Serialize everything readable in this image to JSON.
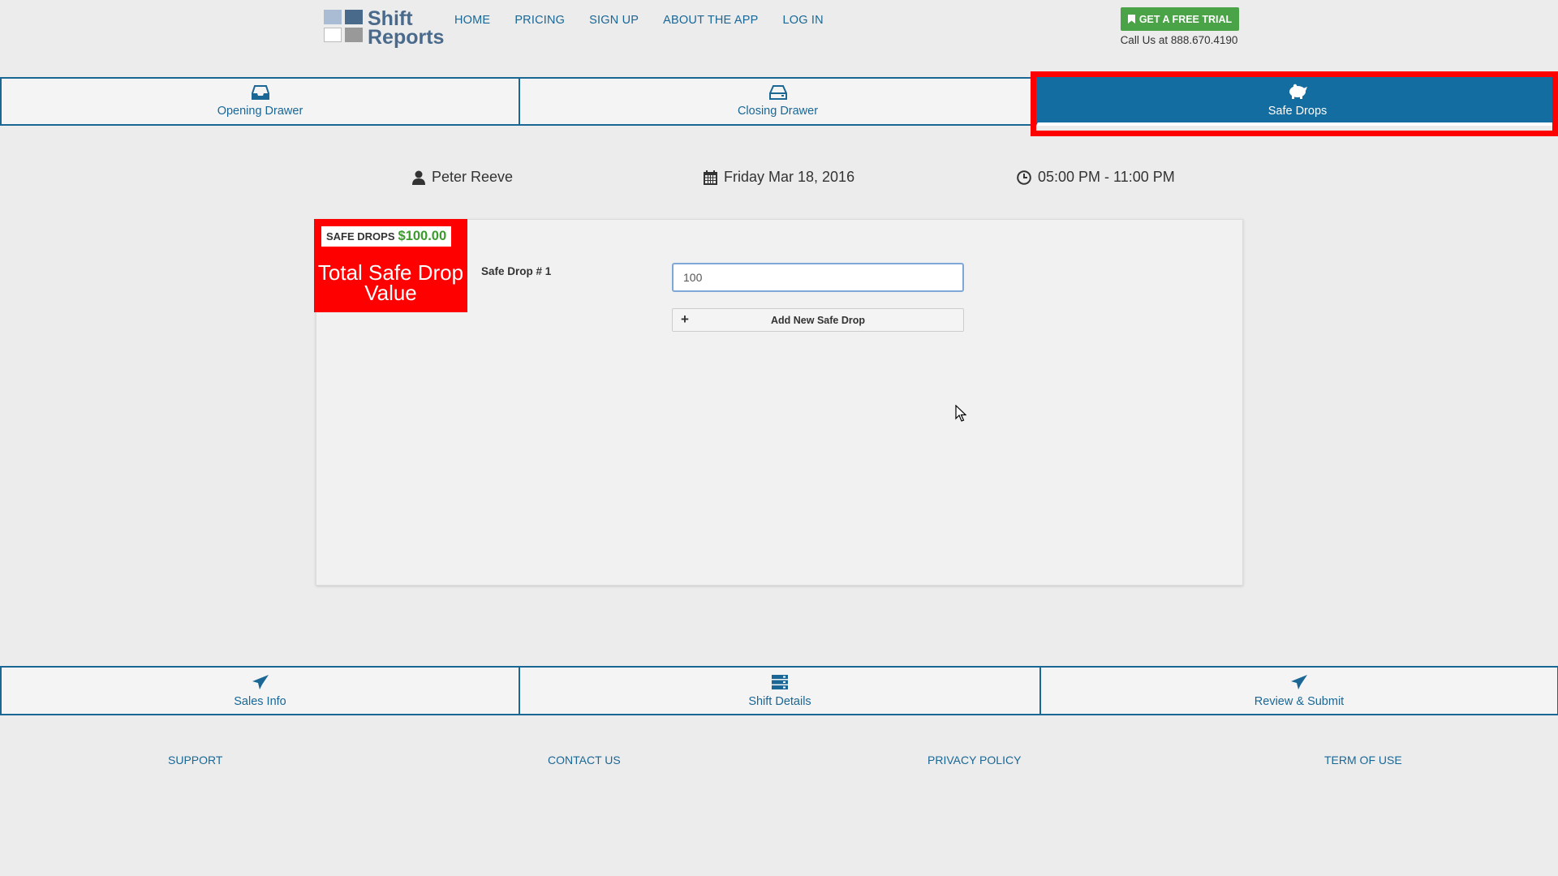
{
  "header": {
    "logo": {
      "line1": "Shift",
      "line2": "Reports"
    },
    "nav": [
      "HOME",
      "PRICING",
      "SIGN UP",
      "ABOUT THE APP",
      "LOG IN"
    ],
    "trial_button": "GET A FREE TRIAL",
    "call_text": "Call Us at 888.670.4190"
  },
  "tabs": [
    {
      "label": "Opening Drawer",
      "icon": "inbox-icon"
    },
    {
      "label": "Closing Drawer",
      "icon": "hdd-icon"
    },
    {
      "label": "Safe Drops",
      "icon": "piggy-bank-icon",
      "active": true
    }
  ],
  "info": {
    "employee": "Peter Reeve",
    "date": "Friday Mar 18, 2016",
    "time": "05:00 PM - 11:00 PM"
  },
  "safe_drops": {
    "badge_label": "SAFE DROPS",
    "badge_amount": "$100.00",
    "callout": "Total Safe Drop Value",
    "drop_label": "Safe Drop # 1",
    "drop_value": "100",
    "add_button": "Add New Safe Drop"
  },
  "bottom_tabs": [
    {
      "label": "Sales Info",
      "icon": "paper-plane-icon"
    },
    {
      "label": "Shift Details",
      "icon": "server-icon"
    },
    {
      "label": "Review & Submit",
      "icon": "paper-plane-icon"
    }
  ],
  "footer": [
    "SUPPORT",
    "CONTACT US",
    "PRIVACY POLICY",
    "TERM OF USE"
  ],
  "colors": {
    "primary": "#1a6795",
    "active_tab": "#146da1",
    "highlight": "#ff0000",
    "trial_green": "#4aa346",
    "amount_green": "#3a9b2c"
  }
}
